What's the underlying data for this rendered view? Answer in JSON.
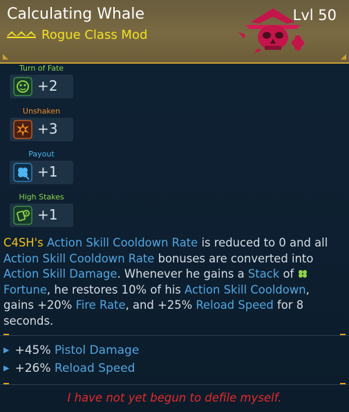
{
  "header": {
    "title": "Calculating Whale",
    "subtitle": "Rogue Class Mod",
    "level": "Lvl 50"
  },
  "colors": {
    "rarity": "#f2e21f",
    "highlight": "#52a6e0",
    "flavor": "#e52a2a",
    "accent": "#e6a01f"
  },
  "skills": [
    {
      "name": "Turn of Fate",
      "value": "+2",
      "icon": "turn-of-fate-icon",
      "label_color": "#8fd34a"
    },
    {
      "name": "Unshaken",
      "value": "+3",
      "icon": "unshaken-icon",
      "label_color": "#f08a25"
    },
    {
      "name": "Payout",
      "value": "+1",
      "icon": "payout-icon",
      "label_color": "#4fb4f0"
    },
    {
      "name": "High Stakes",
      "value": "+1",
      "icon": "high-stakes-icon",
      "label_color": "#8fd34a"
    }
  ],
  "description": {
    "p1": "C4SH's",
    "p2": " ",
    "p3": "Action Skill Cooldown Rate",
    "p4": " is reduced to 0 and all ",
    "p5": "Action Skill Cooldown Rate",
    "p6": " bonuses are converted into ",
    "p7": "Action Skill Damage",
    "p8": ". Whenever he gains a ",
    "p9": "Stack",
    "p10": " of ",
    "p11": "Fortune",
    "p12": ", he restores 10% of his ",
    "p13": "Action Skill Cooldown",
    "p14": ", gains +20% ",
    "p15": "Fire Rate",
    "p16": ", and +25% ",
    "p17": "Reload Speed",
    "p18": " for 8 seconds."
  },
  "bonuses": [
    {
      "amount": "+45%",
      "stat": "Pistol Damage"
    },
    {
      "amount": "+26%",
      "stat": "Reload Speed"
    }
  ],
  "flavor": "I have not yet begun to defile myself."
}
